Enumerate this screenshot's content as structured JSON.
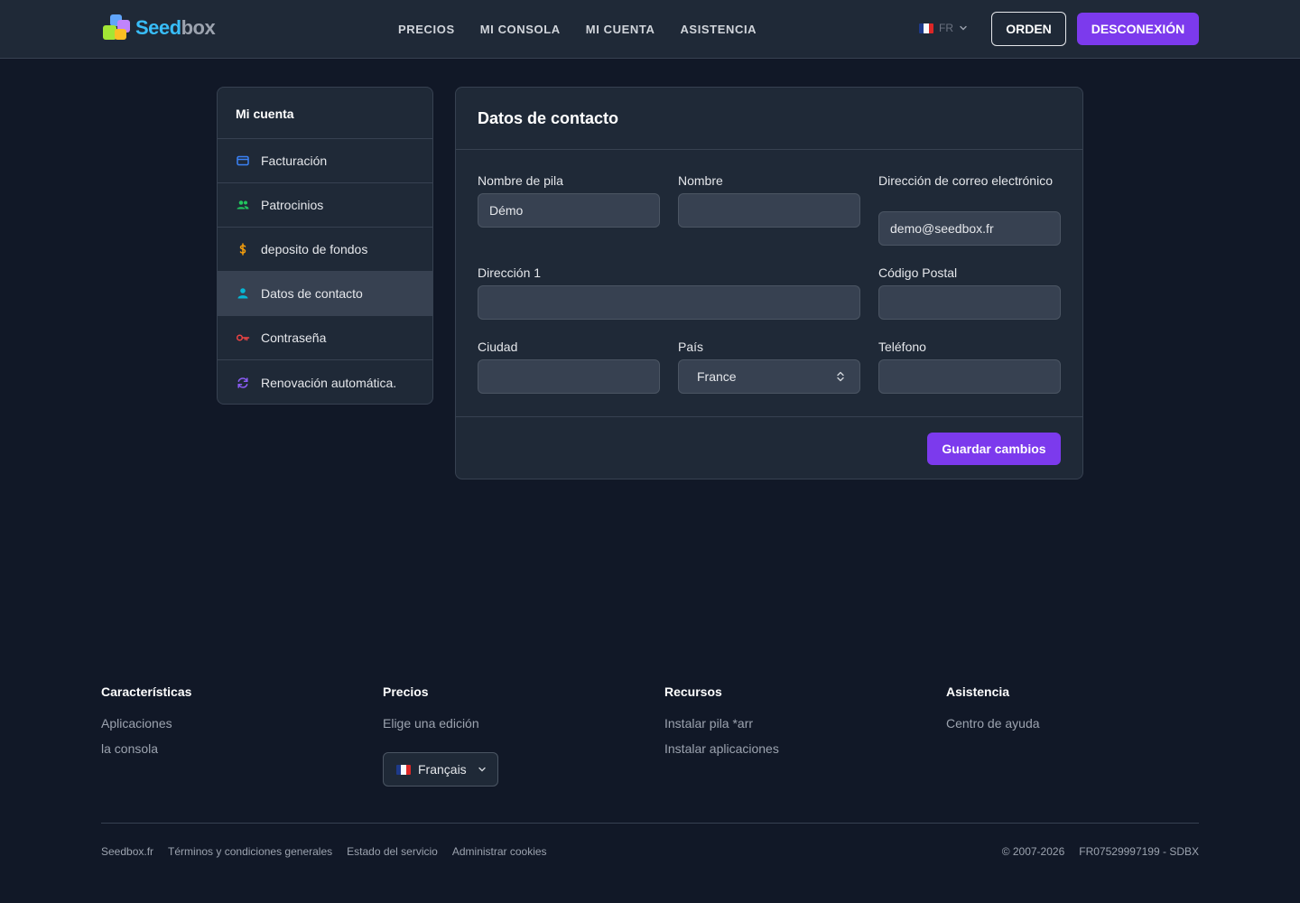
{
  "header": {
    "logo_seed": "Seed",
    "logo_box": "box",
    "nav": [
      "PRECIOS",
      "MI CONSOLA",
      "MI CUENTA",
      "ASISTENCIA"
    ],
    "lang": "FR",
    "order": "ORDEN",
    "logout": "DESCONEXIÓN"
  },
  "sidebar": {
    "title": "Mi cuenta",
    "items": [
      {
        "label": "Facturación",
        "icon": "credit-card-icon",
        "color": "#3b82f6"
      },
      {
        "label": "Patrocinios",
        "icon": "users-icon",
        "color": "#22c55e"
      },
      {
        "label": "deposito de fondos",
        "icon": "dollar-icon",
        "color": "#f59e0b"
      },
      {
        "label": "Datos de contacto",
        "icon": "user-icon",
        "color": "#06b6d4"
      },
      {
        "label": "Contraseña",
        "icon": "key-icon",
        "color": "#ef4444"
      },
      {
        "label": "Renovación automática.",
        "icon": "refresh-icon",
        "color": "#8b5cf6"
      }
    ],
    "active_index": 3
  },
  "form": {
    "title": "Datos de contacto",
    "first_name_label": "Nombre de pila",
    "first_name_value": "Démo",
    "last_name_label": "Nombre",
    "last_name_value": "",
    "email_label": "Dirección de correo electrónico",
    "email_value": "demo@seedbox.fr",
    "address_label": "Dirección 1",
    "address_value": "",
    "postal_label": "Código Postal",
    "postal_value": "",
    "city_label": "Ciudad",
    "city_value": "",
    "country_label": "País",
    "country_value": "France",
    "phone_label": "Teléfono",
    "phone_value": "",
    "save": "Guardar cambios"
  },
  "footer": {
    "columns": [
      {
        "title": "Características",
        "links": [
          "Aplicaciones",
          "la consola"
        ]
      },
      {
        "title": "Precios",
        "links": [
          "Elige una edición"
        ]
      },
      {
        "title": "Recursos",
        "links": [
          "Instalar pila *arr",
          "Instalar aplicaciones"
        ]
      },
      {
        "title": "Asistencia",
        "links": [
          "Centro de ayuda"
        ]
      }
    ],
    "language": "Français",
    "legal": [
      "Seedbox.fr",
      "Términos y condiciones generales",
      "Estado del servicio",
      "Administrar cookies"
    ],
    "copyright": "© 2007-2026",
    "company_id": "FR07529997199 - SDBX"
  },
  "colors": {
    "accent": "#7c3aed",
    "background": "#111827",
    "surface": "#1f2937"
  }
}
